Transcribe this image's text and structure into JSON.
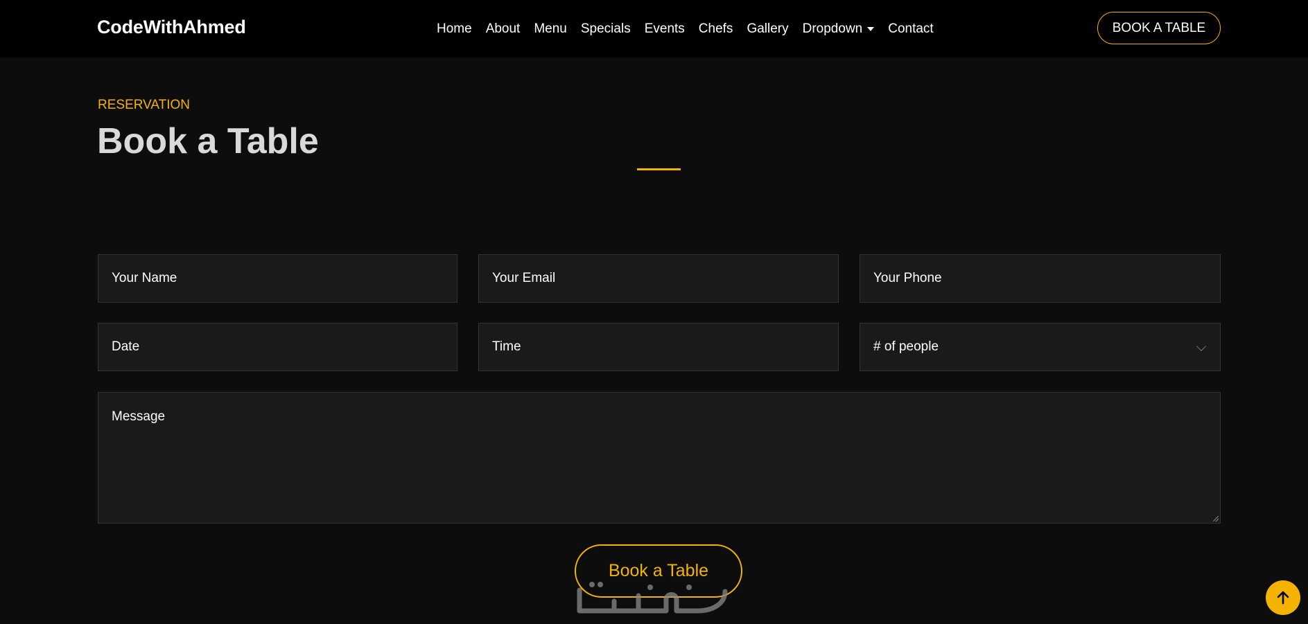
{
  "navbar": {
    "brand": "CodeWithAhmed",
    "items": [
      {
        "label": "Home"
      },
      {
        "label": "About"
      },
      {
        "label": "Menu"
      },
      {
        "label": "Specials"
      },
      {
        "label": "Events"
      },
      {
        "label": "Chefs"
      },
      {
        "label": "Gallery"
      },
      {
        "label": "Dropdown"
      },
      {
        "label": "Contact"
      }
    ],
    "cta_label": "BOOK A TABLE"
  },
  "section": {
    "subtitle": "RESERVATION",
    "title": "Book a Table"
  },
  "form": {
    "name_placeholder": "Your Name",
    "email_placeholder": "Your Email",
    "phone_placeholder": "Your Phone",
    "date_placeholder": "Date",
    "time_placeholder": "Time",
    "people_selected": "# of people",
    "message_placeholder": "Message",
    "submit_label": "Book a Table"
  },
  "colors": {
    "accent": "#f5b301",
    "background": "#0d0d0d",
    "navbar": "#000000",
    "field_bg": "#1a1a1a"
  },
  "icons": {
    "scroll_top": "arrow-up-icon",
    "select": "chevron-down-icon",
    "dropdown": "caret-down-icon"
  }
}
